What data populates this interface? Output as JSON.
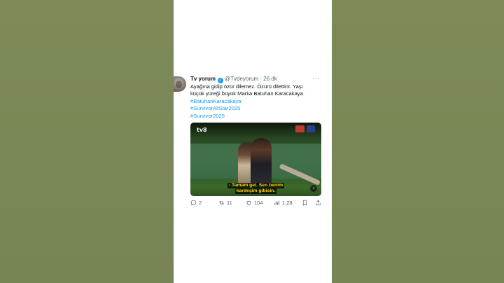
{
  "tweet": {
    "author_name": "Tv yorum",
    "handle": "@Tvdeyorum",
    "separator": "·",
    "time": "26 dk",
    "text_lines": [
      "Ayağına gidip özür dilemez. Özürü dilettirir. Yaşı",
      "küçük yüreği büyük Marka Batuhan Karacakaya."
    ],
    "hashtags": [
      "#BatuhanKaracakaya",
      "#SurvivorAllStar2025",
      "#Survivor2025"
    ],
    "more_label": "···"
  },
  "media": {
    "subtitle_line1": "- Tamam gel. Sen benim",
    "subtitle_line2": "kardeşim gibisin.",
    "logo": "tv8",
    "mute_icon": "speaker-icon"
  },
  "actions": {
    "replies": "2",
    "retweets": "11",
    "likes": "104",
    "views": "1,28"
  },
  "colors": {
    "accent": "#1d9bf0",
    "background_side": "#7f8c5a",
    "subtitle": "#ffd400"
  }
}
